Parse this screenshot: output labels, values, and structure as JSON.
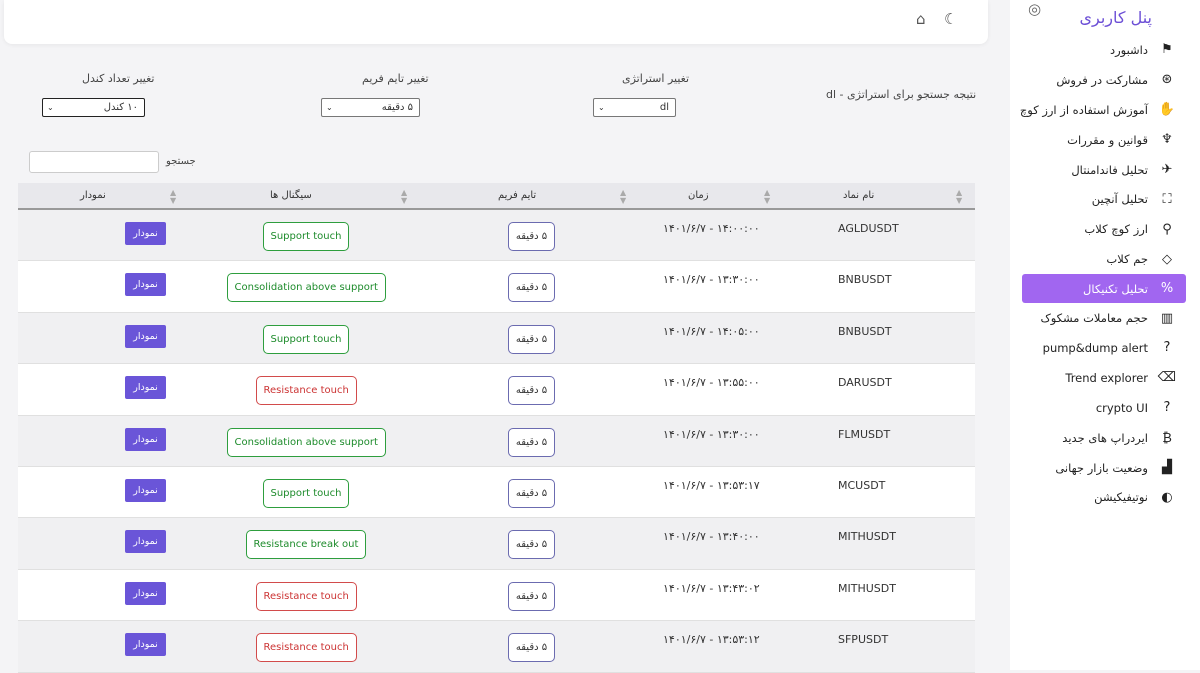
{
  "sidebar": {
    "title": "پنل کاربری",
    "title_icon": "target-icon",
    "items": [
      {
        "label": "داشبورد",
        "icon": "⚑"
      },
      {
        "label": "مشارکت در فروش",
        "icon": "⊛"
      },
      {
        "label": "آموزش استفاده از ارز کوچ",
        "icon": "✋"
      },
      {
        "label": "قوانین و مقررات",
        "icon": "♆"
      },
      {
        "label": "تحلیل فاندامنتال",
        "icon": "✈"
      },
      {
        "label": "تحلیل آنچین",
        "icon": "⛶"
      },
      {
        "label": "ارز کوچ کلاب",
        "icon": "⚲"
      },
      {
        "label": "جم کلاب",
        "icon": "◇"
      },
      {
        "label": "تحلیل تکنیکال",
        "icon": "%",
        "active": true
      },
      {
        "label": "حجم معاملات مشکوک",
        "icon": "▥"
      },
      {
        "label": "pump&dump alert",
        "icon": "?"
      },
      {
        "label": "Trend explorer",
        "icon": "⌫"
      },
      {
        "label": "crypto UI",
        "icon": "?"
      },
      {
        "label": "ایردراپ های جدید",
        "icon": "₿"
      },
      {
        "label": "وضعیت بازار جهانی",
        "icon": "▟"
      },
      {
        "label": "نوتیفیکیشن",
        "icon": "◐"
      }
    ]
  },
  "header": {
    "theme_icon": "☾",
    "home_icon": "⌂"
  },
  "filters": {
    "result_text": "نتیجه جستجو برای استراتژی - dl",
    "strategy_label": "تغییر استراتژی",
    "strategy_value": "dl",
    "timeframe_label": "تغییر تایم فریم",
    "timeframe_value": "۵ دقیقه",
    "candles_label": "تغییر تعداد کندل",
    "candles_value": "۱۰ کندل",
    "search_label": "جستجو"
  },
  "table": {
    "columns": {
      "symbol": "نام نماد",
      "time": "زمان",
      "timeframe": "تایم فریم",
      "signals": "سیگنال ها",
      "chart": "نمودار"
    },
    "rows": [
      {
        "symbol": "AGLDUSDT",
        "time": "۱۴۰۱/۶/۷ - ۱۴:۰۰:۰۰",
        "timeframe": "۵ دقیقه",
        "signal": "Support touch",
        "signal_color": "green",
        "chart": "نمودار"
      },
      {
        "symbol": "BNBUSDT",
        "time": "۱۴۰۱/۶/۷ - ۱۳:۳۰:۰۰",
        "timeframe": "۵ دقیقه",
        "signal": "Consolidation above support",
        "signal_color": "green",
        "chart": "نمودار"
      },
      {
        "symbol": "BNBUSDT",
        "time": "۱۴۰۱/۶/۷ - ۱۴:۰۵:۰۰",
        "timeframe": "۵ دقیقه",
        "signal": "Support touch",
        "signal_color": "green",
        "chart": "نمودار"
      },
      {
        "symbol": "DARUSDT",
        "time": "۱۴۰۱/۶/۷ - ۱۳:۵۵:۰۰",
        "timeframe": "۵ دقیقه",
        "signal": "Resistance touch",
        "signal_color": "red",
        "chart": "نمودار"
      },
      {
        "symbol": "FLMUSDT",
        "time": "۱۴۰۱/۶/۷ - ۱۳:۳۰:۰۰",
        "timeframe": "۵ دقیقه",
        "signal": "Consolidation above support",
        "signal_color": "green",
        "chart": "نمودار"
      },
      {
        "symbol": "MCUSDT",
        "time": "۱۴۰۱/۶/۷ - ۱۳:۵۳:۱۷",
        "timeframe": "۵ دقیقه",
        "signal": "Support touch",
        "signal_color": "green",
        "chart": "نمودار"
      },
      {
        "symbol": "MITHUSDT",
        "time": "۱۴۰۱/۶/۷ - ۱۳:۴۰:۰۰",
        "timeframe": "۵ دقیقه",
        "signal": "Resistance break out",
        "signal_color": "green",
        "chart": "نمودار"
      },
      {
        "symbol": "MITHUSDT",
        "time": "۱۴۰۱/۶/۷ - ۱۳:۴۳:۰۲",
        "timeframe": "۵ دقیقه",
        "signal": "Resistance touch",
        "signal_color": "red",
        "chart": "نمودار"
      },
      {
        "symbol": "SFPUSDT",
        "time": "۱۴۰۱/۶/۷ - ۱۳:۵۳:۱۲",
        "timeframe": "۵ دقیقه",
        "signal": "Resistance touch",
        "signal_color": "red",
        "chart": "نمودار"
      }
    ]
  }
}
